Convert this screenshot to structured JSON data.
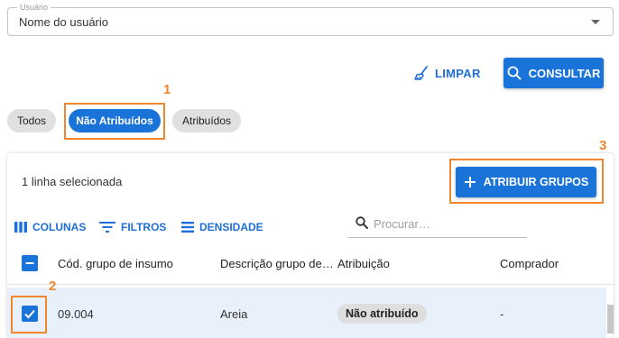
{
  "user_field": {
    "label": "Usuário",
    "value": "Nome do usuário"
  },
  "actions": {
    "clear_label": "LIMPAR",
    "consult_label": "CONSULTAR"
  },
  "filter_chips": [
    {
      "label": "Todos",
      "selected": false
    },
    {
      "label": "Não Atribuídos",
      "selected": true
    },
    {
      "label": "Atribuídos",
      "selected": false
    }
  ],
  "annotations": [
    "1",
    "2",
    "3"
  ],
  "table": {
    "selected_text": "1 linha selecionada",
    "assign_button": "ATRIBUIR GRUPOS",
    "toolbar": {
      "columns": "COLUNAS",
      "filters": "FILTROS",
      "density": "DENSIDADE"
    },
    "search_placeholder": "Procurar…",
    "columns": [
      "Cód. grupo de insumo",
      "Descrição grupo de…",
      "Atribuição",
      "Comprador"
    ],
    "rows": [
      {
        "code": "09.004",
        "description": "Areia",
        "status": "Não atribuído",
        "buyer": "-",
        "checked": true
      }
    ]
  },
  "colors": {
    "primary": "#1a73d8",
    "annotation": "#f0862e",
    "row_selected": "#e8f0fb"
  }
}
